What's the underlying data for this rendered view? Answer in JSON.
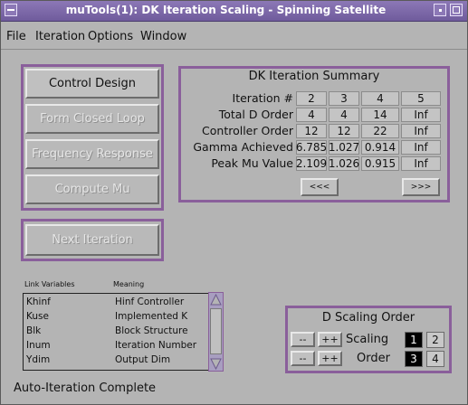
{
  "window": {
    "title": "muTools(1): DK Iteration Scaling - Spinning Satellite"
  },
  "menu": [
    "File",
    "Iteration",
    "Options",
    "Window"
  ],
  "actions": {
    "control_design": "Control Design",
    "form_closed_loop": "Form Closed Loop",
    "frequency_response": "Frequency Response",
    "compute_mu": "Compute Mu",
    "next_iteration": "Next Iteration"
  },
  "summary": {
    "title": "DK Iteration Summary",
    "rows": [
      {
        "label": "Iteration #",
        "values": [
          "2",
          "3",
          "4",
          "5"
        ]
      },
      {
        "label": "Total D Order",
        "values": [
          "4",
          "4",
          "14",
          "Inf"
        ]
      },
      {
        "label": "Controller Order",
        "values": [
          "12",
          "12",
          "22",
          "Inf"
        ]
      },
      {
        "label": "Gamma Achieved",
        "values": [
          "6.785",
          "1.027",
          "0.914",
          "Inf"
        ]
      },
      {
        "label": "Peak Mu Value",
        "values": [
          "2.109",
          "1.026",
          "0.915",
          "Inf"
        ]
      }
    ],
    "prev_label": "<<<",
    "next_label": ">>>"
  },
  "link_variables": {
    "col1": "Link Variables",
    "col2": "Meaning",
    "rows": [
      {
        "name": "Khinf",
        "meaning": "Hinf Controller"
      },
      {
        "name": "Kuse",
        "meaning": "Implemented K"
      },
      {
        "name": "Blk",
        "meaning": "Block Structure"
      },
      {
        "name": "Inum",
        "meaning": "Iteration Number"
      },
      {
        "name": "Ydim",
        "meaning": "Output Dim"
      }
    ],
    "scroll_up_icon": "triangle-up-icon",
    "scroll_down_icon": "triangle-down-icon"
  },
  "dscaling": {
    "title": "D Scaling Order",
    "dec_label": "--",
    "inc_label": "++",
    "scaling_label": "Scaling",
    "order_label": "Order",
    "scaling_values": [
      "1",
      "2"
    ],
    "order_values": [
      "3",
      "4"
    ]
  },
  "status": "Auto-Iteration Complete",
  "colors": {
    "titlebar": "#7a66a8",
    "frame": "#8a5f9b",
    "background": "#b4b4b4"
  }
}
